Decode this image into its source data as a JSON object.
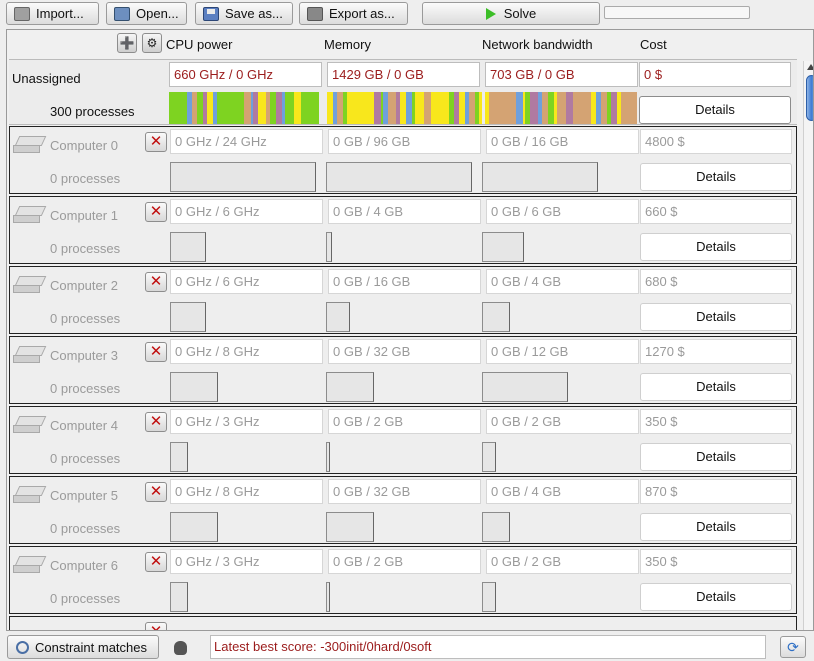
{
  "toolbar": {
    "import_label": "Import...",
    "open_label": "Open...",
    "save_label": "Save as...",
    "export_label": "Export as...",
    "solve_label": "Solve",
    "progress": 0
  },
  "columns": {
    "cpu": "CPU power",
    "memory": "Memory",
    "network": "Network bandwidth",
    "cost": "Cost"
  },
  "unassigned": {
    "title": "Unassigned",
    "processes": "300 processes",
    "cpu": "660 GHz / 0 GHz",
    "memory": "1429 GB / 0 GB",
    "network": "703 GB / 0 GB",
    "cost": "0 $",
    "details_label": "Details"
  },
  "computers": [
    {
      "name": "Computer 0",
      "processes": "0 processes",
      "cpu": "0 GHz / 24 GHz",
      "memory": "0 GB / 96 GB",
      "network": "0 GB / 16 GB",
      "cost": "4800 $",
      "details_label": "Details"
    },
    {
      "name": "Computer 1",
      "processes": "0 processes",
      "cpu": "0 GHz / 6 GHz",
      "memory": "0 GB / 4 GB",
      "network": "0 GB / 6 GB",
      "cost": "660 $",
      "details_label": "Details"
    },
    {
      "name": "Computer 2",
      "processes": "0 processes",
      "cpu": "0 GHz / 6 GHz",
      "memory": "0 GB / 16 GB",
      "network": "0 GB / 4 GB",
      "cost": "680 $",
      "details_label": "Details"
    },
    {
      "name": "Computer 3",
      "processes": "0 processes",
      "cpu": "0 GHz / 8 GHz",
      "memory": "0 GB / 32 GB",
      "network": "0 GB / 12 GB",
      "cost": "1270 $",
      "details_label": "Details"
    },
    {
      "name": "Computer 4",
      "processes": "0 processes",
      "cpu": "0 GHz / 3 GHz",
      "memory": "0 GB / 2 GB",
      "network": "0 GB / 2 GB",
      "cost": "350 $",
      "details_label": "Details"
    },
    {
      "name": "Computer 5",
      "processes": "0 processes",
      "cpu": "0 GHz / 8 GHz",
      "memory": "0 GB / 32 GB",
      "network": "0 GB / 4 GB",
      "cost": "870 $",
      "details_label": "Details"
    },
    {
      "name": "Computer 6",
      "processes": "0 processes",
      "cpu": "0 GHz / 3 GHz",
      "memory": "0 GB / 2 GB",
      "network": "0 GB / 2 GB",
      "cost": "350 $",
      "details_label": "Details"
    }
  ],
  "status": {
    "constraint_matches_label": "Constraint matches",
    "score_text": "Latest best score: -300init/0hard/0soft"
  },
  "colors": {
    "score_red": "#9b1c1c",
    "process_palette": [
      "#7ed321",
      "#f8e71c",
      "#d4a373",
      "#b07aa1",
      "#6fa0dc"
    ]
  }
}
